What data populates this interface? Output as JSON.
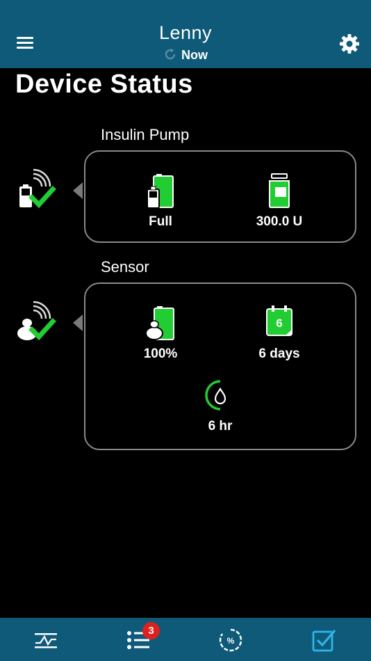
{
  "header": {
    "title": "Lenny",
    "sync_status": "Now",
    "menu_icon": "hamburger-menu-icon",
    "settings_icon": "gear-icon",
    "refresh_icon": "refresh-icon",
    "background_color": "#0e5a78"
  },
  "page": {
    "title": "Device Status"
  },
  "insulin_pump": {
    "label": "Insulin Pump",
    "connection_icon": "pump-connected-check-icon",
    "battery": {
      "icon": "pump-battery-icon",
      "value": "Full",
      "level": 1.0
    },
    "reservoir": {
      "icon": "insulin-reservoir-icon",
      "value": "300.0 U"
    }
  },
  "sensor": {
    "label": "Sensor",
    "connection_icon": "sensor-connected-check-icon",
    "battery": {
      "icon": "sensor-battery-icon",
      "value": "100%",
      "level": 1.0
    },
    "life": {
      "icon": "calendar-icon",
      "days_number": "6",
      "value": "6 days"
    },
    "calibration": {
      "icon": "calibration-timer-drop-icon",
      "value": "6 hr"
    }
  },
  "tabbar": {
    "tabs": [
      {
        "name": "trends",
        "icon": "trend-graph-icon",
        "active": false
      },
      {
        "name": "events",
        "icon": "list-icon",
        "active": false,
        "badge": "3"
      },
      {
        "name": "time-in-range",
        "icon": "percent-gauge-icon",
        "active": false
      },
      {
        "name": "status",
        "icon": "checkbox-icon",
        "active": true
      }
    ],
    "active_color": "#2fb4ea"
  },
  "colors": {
    "ok_green": "#22cc33",
    "card_border": "#8a8a8a",
    "badge_red": "#e0201c"
  }
}
